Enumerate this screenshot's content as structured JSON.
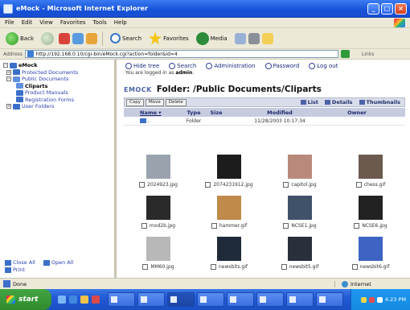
{
  "window": {
    "title": "eMock - Microsoft Internet Explorer"
  },
  "menu": [
    "File",
    "Edit",
    "View",
    "Favorites",
    "Tools",
    "Help"
  ],
  "toolbar": {
    "back": "Back",
    "search": "Search",
    "favorites": "Favorites",
    "media": "Media"
  },
  "address": {
    "label": "Address",
    "url": "http://192.168.0.10/cgi-bin/eMock.cgi?action=folder&id=4",
    "links": "Links"
  },
  "tree": {
    "root": "eMock",
    "items": [
      {
        "label": "Protected Documents"
      },
      {
        "label": "Public Documents"
      },
      {
        "label": "Cliparts",
        "selected": true
      },
      {
        "label": "Product Manuals"
      },
      {
        "label": "Registration Forms"
      },
      {
        "label": "User Folders"
      }
    ]
  },
  "sidebar_footer": {
    "close_all": "Close All",
    "open_all": "Open All",
    "print": "Print"
  },
  "topnav": {
    "hide_tree": "Hide tree",
    "search": "Search",
    "administration": "Administration",
    "password": "Password",
    "logout": "Log out"
  },
  "session": {
    "logged_in_prefix": "You are logged in as",
    "user": "admin"
  },
  "folder": {
    "brand": "EMOCK",
    "title": "Folder: /Public Documents/Cliparts"
  },
  "actions": {
    "copy": "Copy",
    "move": "Move",
    "delete": "Delete"
  },
  "views": {
    "list": "List",
    "details": "Details",
    "thumbnails": "Thumbnails"
  },
  "table": {
    "headers": {
      "name": "Name",
      "type": "Type",
      "size": "Size",
      "modified": "Modified",
      "owner": "Owner"
    },
    "up_row": {
      "type": "Folder",
      "modified": "11/28/2003 10:17:34"
    }
  },
  "files": [
    {
      "name": "2024923.jpg",
      "color": "#9aa3ad"
    },
    {
      "name": "2074231912.jpg",
      "color": "#1c1c1c"
    },
    {
      "name": "capitol.jpg",
      "color": "#b98a7c"
    },
    {
      "name": "chess.gif",
      "color": "#6d5a4e"
    },
    {
      "name": "mod2b.jpg",
      "color": "#2a2a2a"
    },
    {
      "name": "hammer.gif",
      "color": "#c08a4a"
    },
    {
      "name": "NCSE1.jpg",
      "color": "#40526a"
    },
    {
      "name": "NCSE6.jpg",
      "color": "#222222"
    },
    {
      "name": "MM60.jpg",
      "color": "#b8b8b8"
    },
    {
      "name": "newsbits.gif",
      "color": "#1f2a3a"
    },
    {
      "name": "newsbit5.gif",
      "color": "#2a2f3c"
    },
    {
      "name": "newsbit6.gif",
      "color": "#3e63c2"
    }
  ],
  "status": {
    "left": "Done",
    "zone": "Internet"
  },
  "taskbar": {
    "start": "start",
    "tasks": [
      "",
      "",
      "",
      "",
      "",
      "",
      "",
      "",
      ""
    ],
    "time": "4:23 PM"
  },
  "colors": {
    "title_bar": "#1651d8",
    "taskbar": "#225ad6",
    "start": "#2e8b2e",
    "table_header": "#c6cbe0"
  }
}
